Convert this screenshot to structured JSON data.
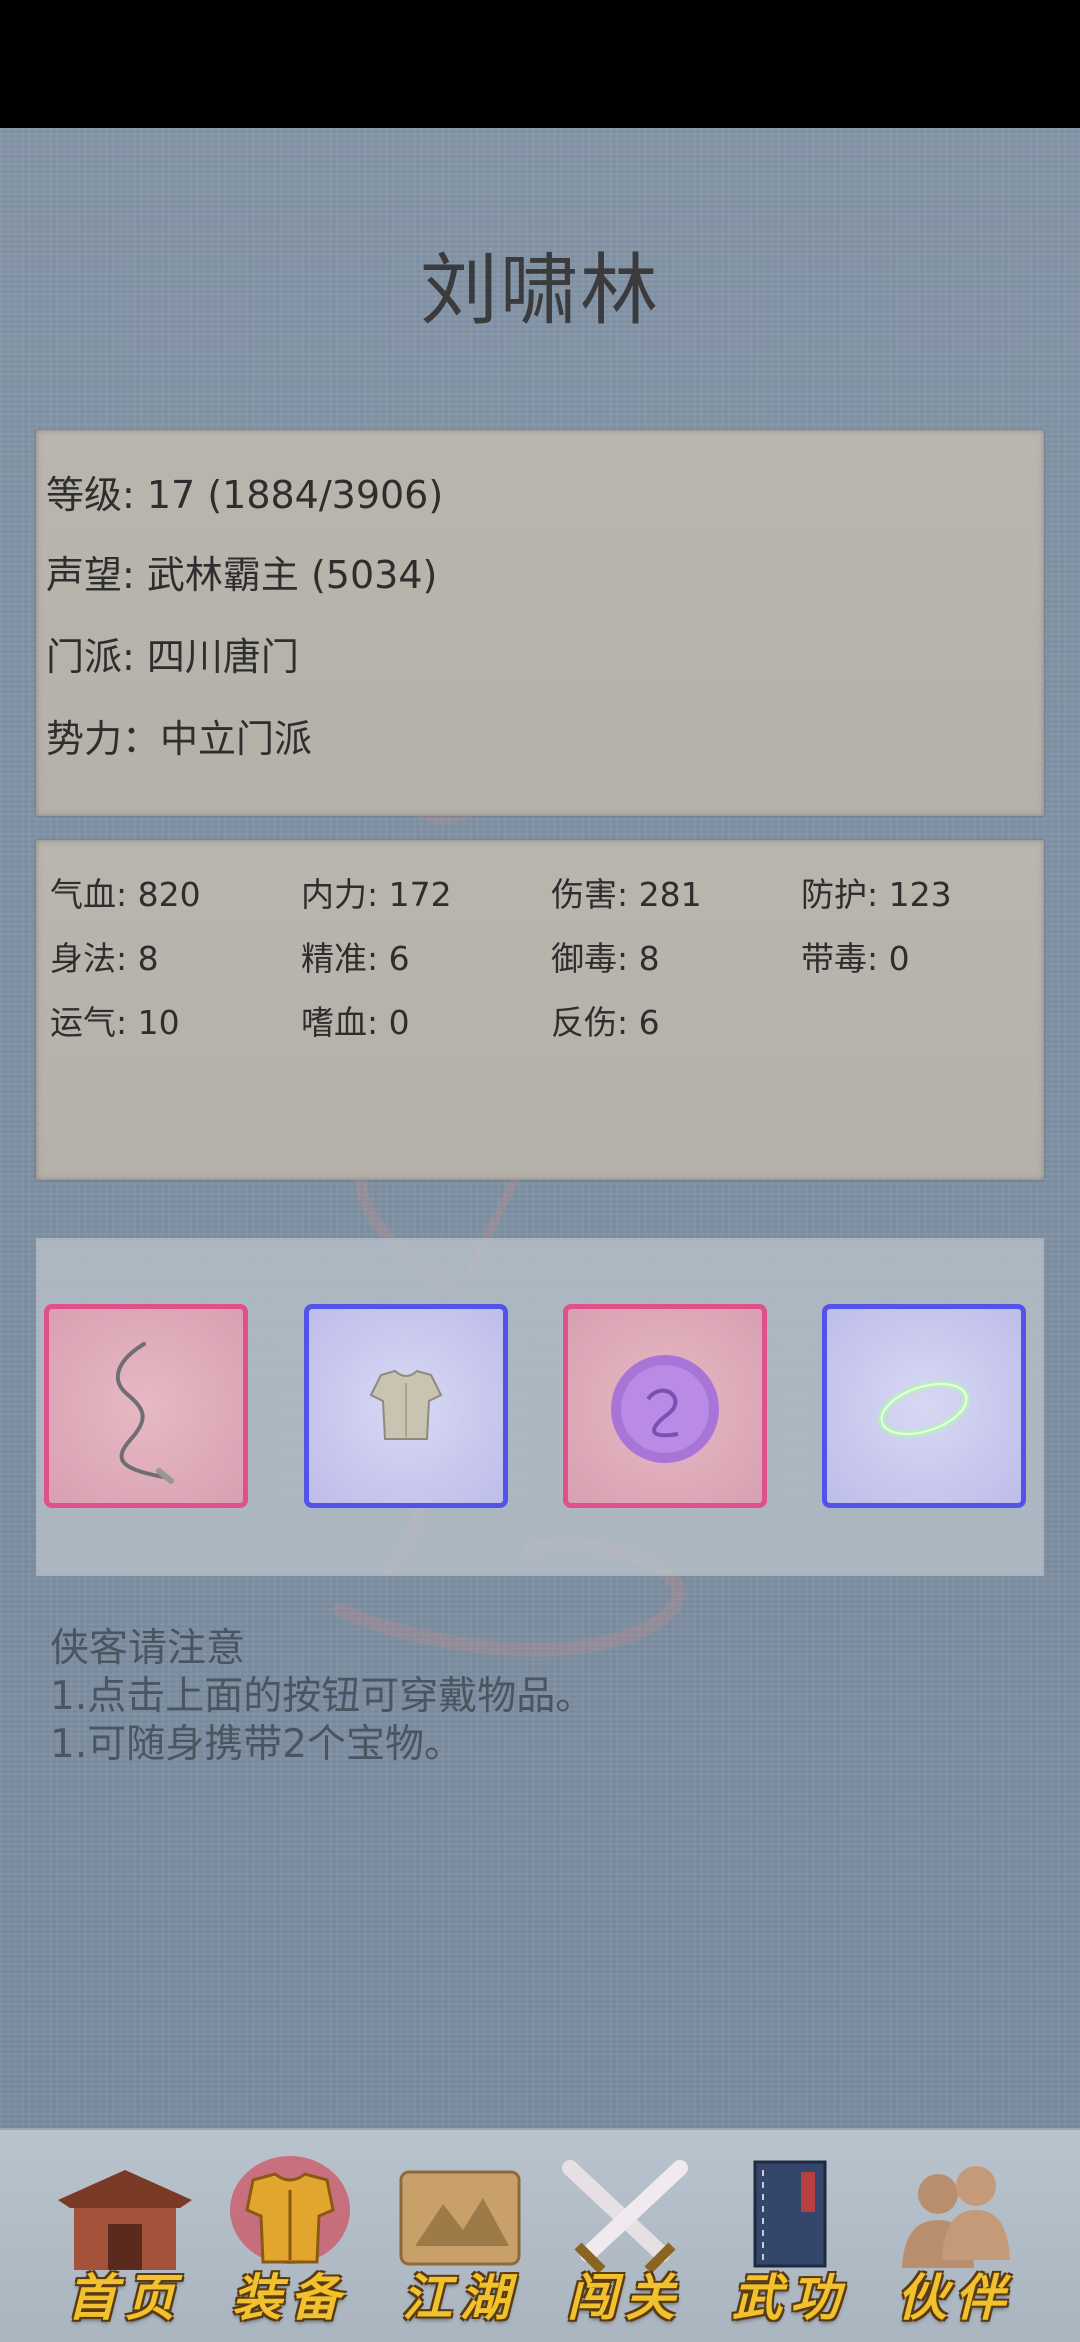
{
  "character": {
    "name": "刘啸林"
  },
  "info": {
    "level": "等级: 17 (1884/3906)",
    "reputation": "声望: 武林霸主 (5034)",
    "sect": "门派: 四川唐门",
    "faction": "势力：中立门派"
  },
  "stats": [
    "气血: 820",
    "内力: 172",
    "伤害: 281",
    "防护: 123",
    "身法: 8",
    "精准: 6",
    "御毒: 8",
    "带毒: 0",
    "运气: 10",
    "嗜血: 0",
    "反伤: 6"
  ],
  "equipment": [
    {
      "icon": "whip-icon",
      "rarity_color": "#e0508a"
    },
    {
      "icon": "cloth-armor-icon",
      "rarity_color": "#5353ea"
    },
    {
      "icon": "purple-gem-icon",
      "rarity_color": "#e0508a"
    },
    {
      "icon": "jade-ring-icon",
      "rarity_color": "#5353ea"
    }
  ],
  "notice": {
    "heading": "侠客请注意",
    "line1": "1.点击上面的按钮可穿戴物品。",
    "line2": "1.可随身携带2个宝物。"
  },
  "nav": [
    {
      "label": "首页",
      "icon": "temple-icon",
      "active": false
    },
    {
      "label": "装备",
      "icon": "armor-icon",
      "active": true
    },
    {
      "label": "江湖",
      "icon": "scroll-map-icon",
      "active": false
    },
    {
      "label": "闯关",
      "icon": "crossed-swords-icon",
      "active": false
    },
    {
      "label": "武功",
      "icon": "book-icon",
      "active": false
    },
    {
      "label": "伙伴",
      "icon": "companions-icon",
      "active": false
    }
  ]
}
